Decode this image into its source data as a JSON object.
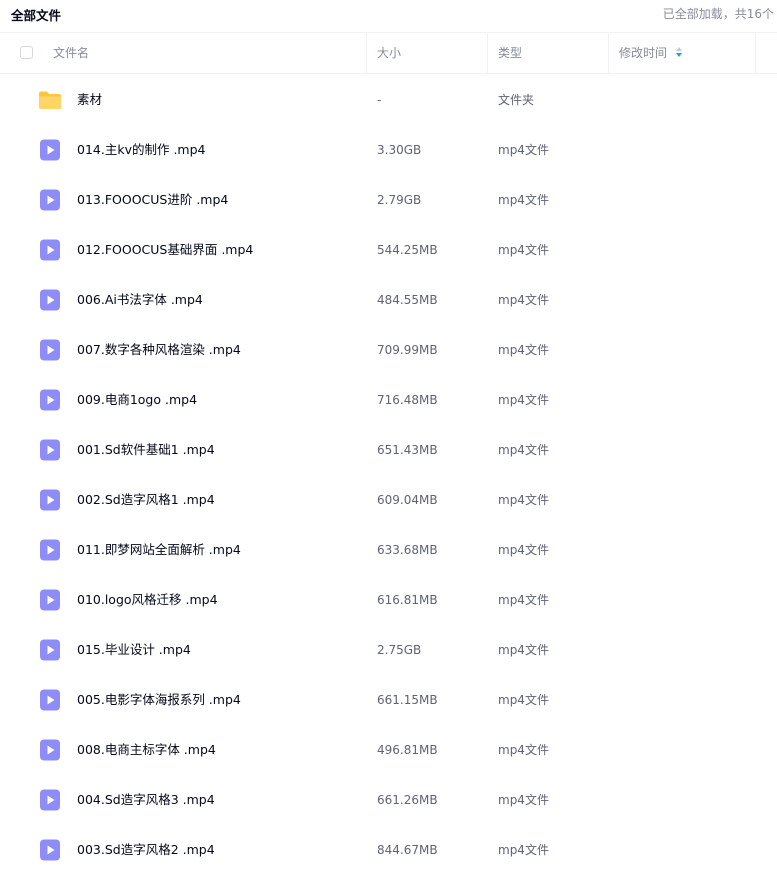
{
  "toolbar": {
    "crumb": "全部文件",
    "load_status": "已全部加载，共16个"
  },
  "header": {
    "name": "文件名",
    "size": "大小",
    "type": "类型",
    "modified": "修改时间"
  },
  "files": [
    {
      "name": "素材",
      "size": "-",
      "type": "文件夹",
      "icon": "folder-icon"
    },
    {
      "name": "014.主kv的制作 .mp4",
      "size": "3.30GB",
      "type": "mp4文件",
      "icon": "video-file-icon"
    },
    {
      "name": "013.FOOOCUS进阶 .mp4",
      "size": "2.79GB",
      "type": "mp4文件",
      "icon": "video-file-icon"
    },
    {
      "name": "012.FOOOCUS基础界面 .mp4",
      "size": "544.25MB",
      "type": "mp4文件",
      "icon": "video-file-icon"
    },
    {
      "name": "006.Ai书法字体 .mp4",
      "size": "484.55MB",
      "type": "mp4文件",
      "icon": "video-file-icon"
    },
    {
      "name": "007.数字各种风格渲染 .mp4",
      "size": "709.99MB",
      "type": "mp4文件",
      "icon": "video-file-icon"
    },
    {
      "name": "009.电商1ogo .mp4",
      "size": "716.48MB",
      "type": "mp4文件",
      "icon": "video-file-icon"
    },
    {
      "name": "001.Sd软件基础1 .mp4",
      "size": "651.43MB",
      "type": "mp4文件",
      "icon": "video-file-icon"
    },
    {
      "name": "002.Sd造字风格1 .mp4",
      "size": "609.04MB",
      "type": "mp4文件",
      "icon": "video-file-icon"
    },
    {
      "name": "011.即梦网站全面解析 .mp4",
      "size": "633.68MB",
      "type": "mp4文件",
      "icon": "video-file-icon"
    },
    {
      "name": "010.logo风格迁移 .mp4",
      "size": "616.81MB",
      "type": "mp4文件",
      "icon": "video-file-icon"
    },
    {
      "name": "015.毕业设计 .mp4",
      "size": "2.75GB",
      "type": "mp4文件",
      "icon": "video-file-icon"
    },
    {
      "name": "005.电影字体海报系列 .mp4",
      "size": "661.15MB",
      "type": "mp4文件",
      "icon": "video-file-icon"
    },
    {
      "name": "008.电商主标字体 .mp4",
      "size": "496.81MB",
      "type": "mp4文件",
      "icon": "video-file-icon"
    },
    {
      "name": "004.Sd造字风格3 .mp4",
      "size": "661.26MB",
      "type": "mp4文件",
      "icon": "video-file-icon"
    },
    {
      "name": "003.Sd造字风格2 .mp4",
      "size": "844.67MB",
      "type": "mp4文件",
      "icon": "video-file-icon"
    }
  ],
  "colors": {
    "accent": "#06a7ff",
    "folder": "#ffc53d",
    "video_icon": "#8e8cf6"
  }
}
